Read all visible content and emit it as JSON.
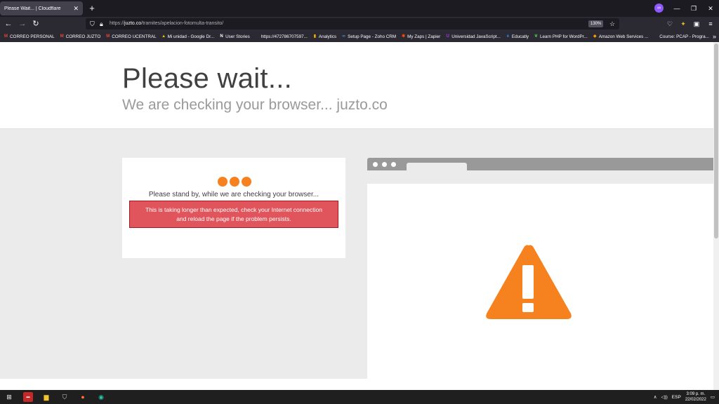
{
  "tab": {
    "title": "Please Wait... | Cloudflare",
    "close": "✕"
  },
  "newtab": "+",
  "window_controls": {
    "minimize": "—",
    "restore": "❐",
    "close": "✕"
  },
  "nav": {
    "back": "←",
    "forward": "→",
    "reload": "↻"
  },
  "url": {
    "prefix": "https://",
    "domain": "juzto.co",
    "path": "/tramites/apelacion-fotomulta-transito/"
  },
  "zoom": "130%",
  "bookmarks": [
    {
      "label": "CORREO PERSONAL",
      "icon": "gmail-icon",
      "color": "#ea4335",
      "glyph": "M"
    },
    {
      "label": "CORREO JUZTO",
      "icon": "gmail-icon",
      "color": "#ea4335",
      "glyph": "M"
    },
    {
      "label": "CORREO UCENTRAL",
      "icon": "gmail-icon",
      "color": "#ea4335",
      "glyph": "M"
    },
    {
      "label": "Mi unidad - Google Dr...",
      "icon": "google-drive-icon",
      "color": "#fbbc04",
      "glyph": "▲"
    },
    {
      "label": "User Stories",
      "icon": "notion-icon",
      "color": "#ffffff",
      "glyph": "N"
    },
    {
      "label": "https://472786707597...",
      "icon": "globe-icon",
      "color": "#2b2a33",
      "glyph": "⊕"
    },
    {
      "label": "Analytics",
      "icon": "analytics-icon",
      "color": "#f9ab00",
      "glyph": "▮"
    },
    {
      "label": "Setup Page - Zoho CRM",
      "icon": "zoho-icon",
      "color": "#3a9ad9",
      "glyph": "∞"
    },
    {
      "label": "My Zaps | Zapier",
      "icon": "zapier-icon",
      "color": "#ff4a00",
      "glyph": "✱"
    },
    {
      "label": "Universidad JavaScript...",
      "icon": "udemy-icon",
      "color": "#a435f0",
      "glyph": "U"
    },
    {
      "label": "Educatly",
      "icon": "educatly-icon",
      "color": "#1a8cff",
      "glyph": "e"
    },
    {
      "label": "Learn PHP for WordPr...",
      "icon": "leaf-icon",
      "color": "#4caf50",
      "glyph": "❦"
    },
    {
      "label": "Amazon Web Services ...",
      "icon": "aws-icon",
      "color": "#ff9900",
      "glyph": "◆"
    },
    {
      "label": "Course: PCAP - Progra...",
      "icon": "course-icon",
      "color": "#2b2a33",
      "glyph": "▭"
    }
  ],
  "bookmarks_more": "»",
  "page": {
    "title": "Please wait...",
    "subtitle": "We are checking your browser... juzto.co",
    "standby": "Please stand by, while we are checking your browser...",
    "alert_line1": "This is taking longer than expected, check your Internet connection",
    "alert_line2": "and reload the page if the problem persists."
  },
  "colors": {
    "accent": "#f6821f",
    "alert_bg": "#e0555c",
    "alert_border": "#a3191f"
  },
  "taskbar": {
    "language": "ESP",
    "time": "3:09 p. m.",
    "date": "22/02/2022"
  }
}
